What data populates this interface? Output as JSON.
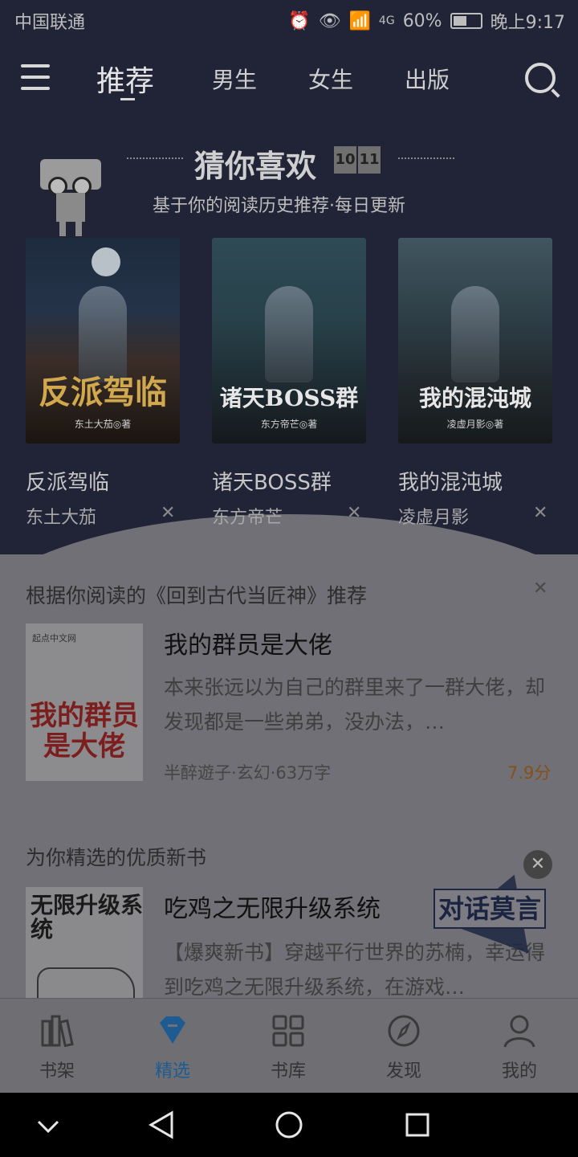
{
  "status_bar": {
    "carrier": "中国联通",
    "network": "4G",
    "battery": "60%",
    "time": "晚上9:17"
  },
  "nav": {
    "tabs": [
      "推荐",
      "男生",
      "女生",
      "出版"
    ],
    "active_tab": "推荐",
    "icons": [
      "menu-icon",
      "search-icon"
    ]
  },
  "guess": {
    "title": "猜你喜欢",
    "calendar": [
      "10",
      "11"
    ],
    "subtitle": "基于你的阅读历史推荐·每日更新",
    "books": [
      {
        "cover_title": "反派驾临",
        "cover_author": "东土大茄◎著",
        "title": "反派驾临",
        "author": "东土大茄"
      },
      {
        "cover_title": "诸天BOSS群",
        "cover_author": "东方帝芒◎著",
        "title": "诸天BOSS群",
        "author": "东方帝芒"
      },
      {
        "cover_title": "我的混沌城",
        "cover_author": "凌虚月影◎著",
        "title": "我的混沌城",
        "author": "凌虚月影"
      }
    ]
  },
  "based_on": {
    "title": "根据你阅读的《回到古代当匠神》推荐",
    "book": {
      "cover_text": "我的群员是大佬",
      "cover_small": "起点中文网",
      "title": "我的群员是大佬",
      "desc": "本来张远以为自己的群里来了一群大佬，却发现都是一些弟弟，没办法，…",
      "meta": "半醉遊子·玄幻·63万字",
      "score": "7.9分"
    }
  },
  "featured": {
    "title": "为你精选的优质新书",
    "book": {
      "cover_text": "无限升级系统",
      "title": "吃鸡之无限升级系统",
      "desc": "【爆爽新书】穿越平行世界的苏楠，幸运得到吃鸡之无限升级系统，在游戏…"
    }
  },
  "floating_badge": "对话莫言",
  "tabbar": {
    "items": [
      {
        "label": "书架",
        "icon": "bookshelf-icon"
      },
      {
        "label": "精选",
        "icon": "diamond-icon"
      },
      {
        "label": "书库",
        "icon": "grid-icon"
      },
      {
        "label": "发现",
        "icon": "compass-icon"
      },
      {
        "label": "我的",
        "icon": "person-icon"
      }
    ],
    "active": "精选"
  },
  "system_nav": [
    "chevron-down-icon",
    "back-icon",
    "home-icon",
    "recents-icon"
  ],
  "colors": {
    "dark_bg": "#202436",
    "content_bg": "#707076",
    "accent": "#1e5b92",
    "score": "#84511c"
  }
}
